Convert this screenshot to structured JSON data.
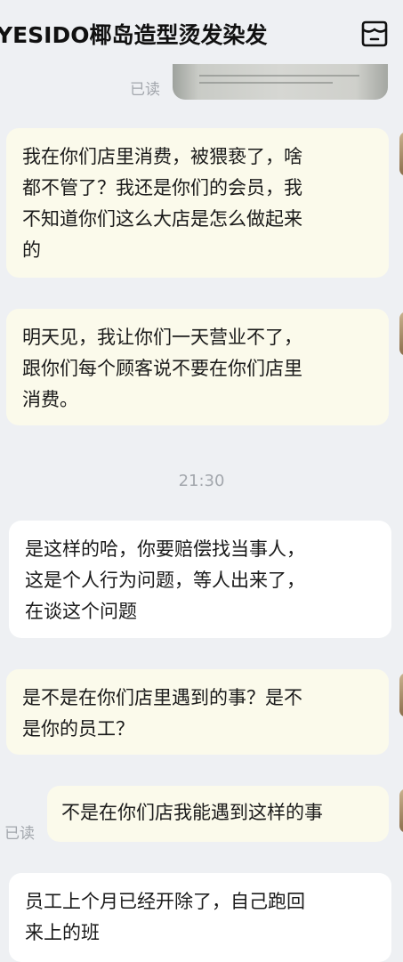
{
  "header": {
    "title": "YESIDO椰岛造型烫发染发",
    "store_icon": "store-icon"
  },
  "messages": [
    {
      "side": "mine",
      "status": "已读",
      "type": "image"
    },
    {
      "side": "mine",
      "lines": [
        "我在你们店里消费，被猥亵了，啥",
        "都不管了？我还是你们的会员，我",
        "不知道你们这么大店是怎么做起来",
        "的"
      ]
    },
    {
      "side": "mine",
      "lines": [
        "明天见，我让你们一天营业不了，",
        "跟你们每个顾客说不要在你们店里",
        "消费。"
      ]
    },
    {
      "type": "time",
      "text": "21:30"
    },
    {
      "side": "theirs",
      "lines": [
        "是这样的哈，你要赔偿找当事人，",
        "这是个人行为问题，等人出来了，",
        "在谈这个问题"
      ]
    },
    {
      "side": "mine",
      "lines": [
        "是不是在你们店里遇到的事？是不",
        "是你的员工？"
      ]
    },
    {
      "side": "mine",
      "status": "已读",
      "lines": [
        "不是在你们店我能遇到这样的事"
      ]
    },
    {
      "side": "theirs",
      "lines": [
        "员工上个月已经开除了，自己跑回",
        "来上的班"
      ]
    }
  ]
}
